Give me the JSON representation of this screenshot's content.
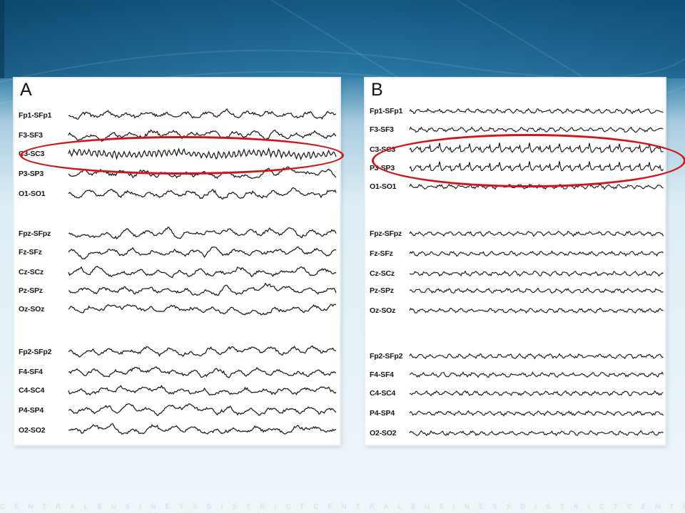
{
  "slide": {
    "footer_text": "CENTRALBUSINESSDISTRICTCENTRALBUSINESSDISTRICTCENTRA"
  },
  "panels": [
    {
      "letter": "A",
      "groups": [
        [
          "Fp1-SFp1",
          "F3-SF3",
          "C3-SC3",
          "P3-SP3",
          "O1-SO1"
        ],
        [
          "Fpz-SFpz",
          "Fz-SFz",
          "Cz-SCz",
          "Pz-SPz",
          "Oz-SOz"
        ],
        [
          "Fp2-SFp2",
          "F4-SF4",
          "C4-SC4",
          "P4-SP4",
          "O2-SO2"
        ]
      ],
      "highlighted_channels": [
        "C3-SC3"
      ]
    },
    {
      "letter": "B",
      "groups": [
        [
          "Fp1-SFp1",
          "F3-SF3",
          "C3-SC3",
          "P3-SP3",
          "O1-SO1"
        ],
        [
          "Fpz-SFpz",
          "Fz-SFz",
          "Cz-SCz",
          "Pz-SPz",
          "Oz-SOz"
        ],
        [
          "Fp2-SFp2",
          "F4-SF4",
          "C4-SC4",
          "P4-SP4",
          "O2-SO2"
        ]
      ],
      "highlighted_channels": [
        "C3-SC3",
        "P3-SP3"
      ]
    }
  ],
  "colors": {
    "highlight": "#d0141a",
    "trace": "#111111",
    "panel_bg": "#ffffff"
  }
}
